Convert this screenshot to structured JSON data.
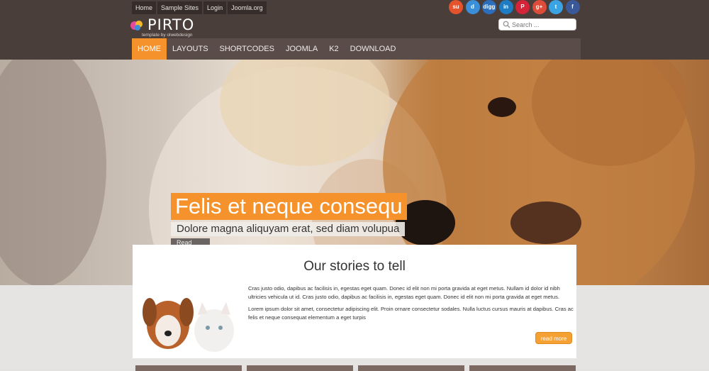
{
  "top_menu": [
    "Home",
    "Sample Sites",
    "Login",
    "Joomla.org"
  ],
  "logo": {
    "name": "PIRTO",
    "tagline": "template by olwebdesign"
  },
  "social": [
    {
      "icon": "stumbleupon-icon",
      "glyph": "su",
      "color": "#e4532c"
    },
    {
      "icon": "delicious-icon",
      "glyph": "d",
      "color": "#3a8fd8"
    },
    {
      "icon": "digg-icon",
      "glyph": "digg",
      "color": "#2d6ebc"
    },
    {
      "icon": "linkedin-icon",
      "glyph": "in",
      "color": "#1d7cc2"
    },
    {
      "icon": "pinterest-icon",
      "glyph": "P",
      "color": "#d5233a"
    },
    {
      "icon": "googleplus-icon",
      "glyph": "g+",
      "color": "#dd4b39"
    },
    {
      "icon": "twitter-icon",
      "glyph": "t",
      "color": "#3aa3e3"
    },
    {
      "icon": "facebook-icon",
      "glyph": "f",
      "color": "#3b5998"
    }
  ],
  "search": {
    "placeholder": "Search ..."
  },
  "nav": [
    "HOME",
    "LAYOUTS",
    "SHORTCODES",
    "JOOMLA",
    "K2",
    "DOWNLOAD"
  ],
  "slide": {
    "title": "Felis et neque consequ",
    "subtitle": "Dolore magna aliquyam erat, sed diam volupua",
    "more": "Read more"
  },
  "section": {
    "title": "Our stories to tell",
    "p1": "Cras justo odio, dapibus ac facilisis in, egestas eget quam. Donec id elit non mi porta gravida at eget metus. Nullam id dolor id nibh ultricies vehicula ut id. Cras justo odio, dapibus ac facilisis in, egestas eget quam. Donec id elit non mi porta gravida at eget metus.",
    "p2": "Lorem ipsum dolor sit amet, consectetur adipiscing elit. Proin ornare consectetur sodales. Nulla luctus cursus mauris at dapibus. Cras ac felis et neque consequat elementum a eget turpis",
    "button": "read more"
  },
  "colors": {
    "accent": "#f5922b",
    "header": "#4a3e3b",
    "nav": "#5a4c49"
  }
}
